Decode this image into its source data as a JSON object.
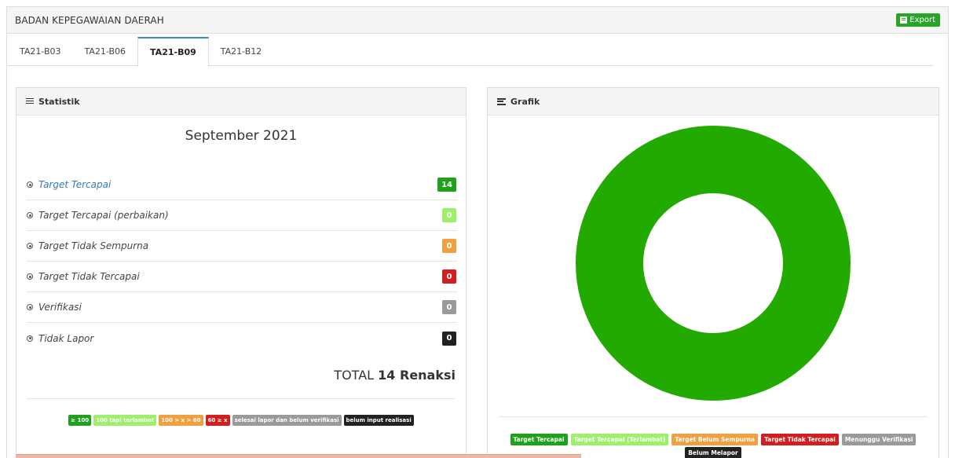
{
  "header": {
    "title": "BADAN KEPEGAWAIAN DAERAH",
    "export_label": "Export",
    "export_color": "#28a528"
  },
  "tabs": [
    {
      "label": "TA21-B03"
    },
    {
      "label": "TA21-B06"
    },
    {
      "label": "TA21-B09",
      "active": true
    },
    {
      "label": "TA21-B12"
    }
  ],
  "statistik": {
    "title": "Statistik",
    "period": "September 2021",
    "rows": [
      {
        "label": "Target Tercapai",
        "count": "14",
        "color": "#1ea21e"
      },
      {
        "label": "Target Tercapai (perbaikan)",
        "count": "0",
        "color": "#9cf06a"
      },
      {
        "label": "Target Tidak Sempurna",
        "count": "0",
        "color": "#f0a040"
      },
      {
        "label": "Target Tidak Tercapai",
        "count": "0",
        "color": "#d21e1e"
      },
      {
        "label": "Verifikasi",
        "count": "0",
        "color": "#9a9a9a"
      },
      {
        "label": "Tidak Lapor",
        "count": "0",
        "color": "#222222"
      }
    ],
    "total_prefix": "TOTAL",
    "total_value": "14 Renaksi",
    "legend": [
      {
        "label": "≥ 100",
        "color": "#1ea21e"
      },
      {
        "label": "100 tapi terlambat",
        "color": "#9cf06a"
      },
      {
        "label": "100 > x > 60",
        "color": "#f0a040"
      },
      {
        "label": "60 ≥ x",
        "color": "#d21e1e"
      },
      {
        "label": "selesai lapor dan belum verifikasi",
        "color": "#9a9a9a"
      },
      {
        "label": "belum input realisasi",
        "color": "#222222"
      }
    ]
  },
  "grafik": {
    "title": "Grafik",
    "legend": [
      {
        "label": "Target Tercapai",
        "color": "#1ea21e"
      },
      {
        "label": "Target Tercapai (Terlambat)",
        "color": "#9cf06a"
      },
      {
        "label": "Target Belum Sempurna",
        "color": "#f0a040"
      },
      {
        "label": "Target Tidak Tercapai",
        "color": "#d21e1e"
      },
      {
        "label": "Menunggu Verifikasi",
        "color": "#9a9a9a"
      },
      {
        "label": "Belum Melapor",
        "color": "#222222"
      }
    ]
  },
  "chart_data": {
    "type": "pie",
    "categories": [
      "Target Tercapai",
      "Target Tercapai (Terlambat)",
      "Target Belum Sempurna",
      "Target Tidak Tercapai",
      "Menunggu Verifikasi",
      "Belum Melapor"
    ],
    "values": [
      14,
      0,
      0,
      0,
      0,
      0
    ],
    "donut": true,
    "colors": [
      "#22aa00",
      "#9cf06a",
      "#f0a040",
      "#d21e1e",
      "#9a9a9a",
      "#222222"
    ],
    "legend_position": "bottom"
  }
}
